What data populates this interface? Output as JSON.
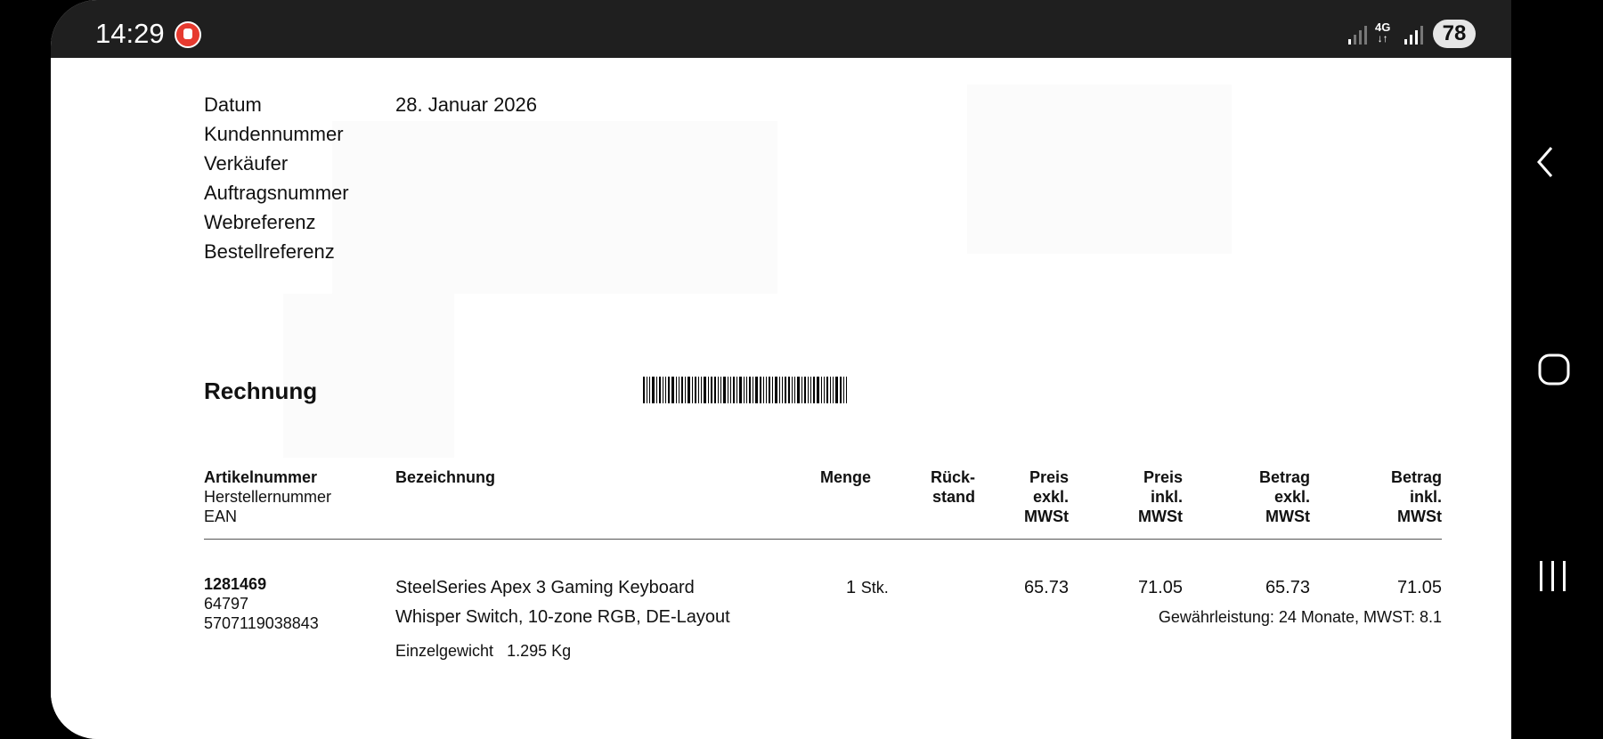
{
  "status_bar": {
    "time": "14:29",
    "network": "4G",
    "battery": "78"
  },
  "document": {
    "info_labels": [
      "Datum",
      "Kundennummer",
      "Verkäufer",
      "Auftragsnummer",
      "Webreferenz",
      "Bestellreferenz"
    ],
    "date_value": "28. Januar 2026",
    "title": "Rechnung",
    "headers": {
      "article": "Artikelnummer",
      "manufacturer": "Herstellernummer",
      "ean": "EAN",
      "description": "Bezeichnung",
      "quantity": "Menge",
      "backorder": [
        "Rück-",
        "stand"
      ],
      "price_excl": [
        "Preis",
        "exkl.",
        "MWSt"
      ],
      "price_incl": [
        "Preis",
        "inkl.",
        "MWSt"
      ],
      "amount_excl": [
        "Betrag",
        "exkl.",
        "MWSt"
      ],
      "amount_incl": [
        "Betrag",
        "inkl.",
        "MWSt"
      ]
    },
    "line_item": {
      "article_no": "1281469",
      "manufacturer_no": "64797",
      "ean": "5707119038843",
      "description_1": "SteelSeries Apex 3 Gaming Keyboard",
      "description_2": "Whisper Switch, 10-zone RGB, DE-Layout",
      "weight_label": "Einzelgewicht",
      "weight_value": "1.295 Kg",
      "quantity": "1",
      "unit": "Stk.",
      "price_excl": "65.73",
      "price_incl": "71.05",
      "amount_excl": "65.73",
      "amount_incl": "71.05",
      "warranty": "Gewährleistung: 24 Monate, MWST: 8.1"
    }
  },
  "nav": {
    "back_icon": "chevron-left",
    "home_icon": "rounded-square",
    "recents_icon": "three-bars"
  }
}
